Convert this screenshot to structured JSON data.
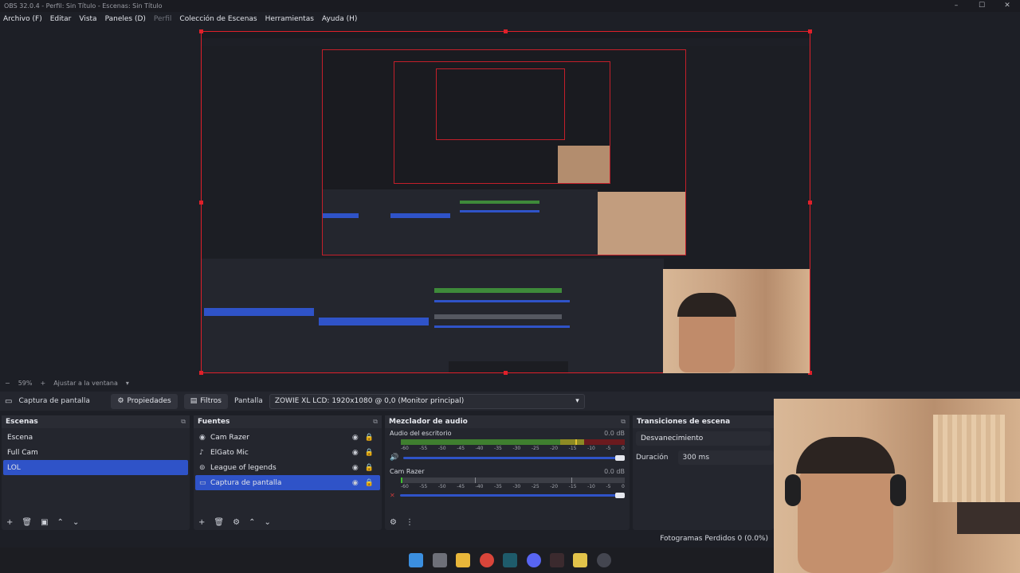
{
  "window": {
    "title": "OBS 32.0.4 - Perfil: Sin Título - Escenas: Sin Título",
    "controls": [
      "–",
      "☐",
      "✕"
    ]
  },
  "menu": {
    "items": [
      "Archivo (F)",
      "Editar",
      "Vista",
      "Paneles (D)",
      "Perfil",
      "Colección de Escenas",
      "Herramientas",
      "Ayuda (H)"
    ]
  },
  "zoom": {
    "minus": "−",
    "level": "59%",
    "plus": "+",
    "fit_label": "Ajustar a la ventana",
    "dropdown": "▾"
  },
  "context": {
    "source_name": "Captura de pantalla",
    "properties_label": "Propiedades",
    "filters_label": "Filtros",
    "display_label": "Pantalla",
    "display_value": "ZOWIE XL LCD: 1920x1080 @ 0,0 (Monitor principal)"
  },
  "scenes": {
    "title": "Escenas",
    "items": [
      "Escena",
      "Full Cam",
      "LOL"
    ],
    "selected_index": 2
  },
  "sources": {
    "title": "Fuentes",
    "items": [
      {
        "icon": "camera-icon",
        "glyph": "◉",
        "label": "Cam Razer"
      },
      {
        "icon": "microphone-icon",
        "glyph": "♪",
        "label": "ElGato Mic"
      },
      {
        "icon": "gamepad-icon",
        "glyph": "⊚",
        "label": "League of legends"
      },
      {
        "icon": "monitor-icon",
        "glyph": "▭",
        "label": "Captura de pantalla"
      }
    ],
    "selected_index": 3
  },
  "mixer": {
    "title": "Mezclador de audio",
    "channels": [
      {
        "name": "Audio del escritorio",
        "db": "0.0 dB",
        "level": 0.78,
        "active": true
      },
      {
        "name": "Cam Razer",
        "db": "0.0 dB",
        "level": 0.0,
        "active": false
      }
    ],
    "ticks": [
      "-60",
      "-55",
      "-50",
      "-45",
      "-40",
      "-35",
      "-30",
      "-25",
      "-20",
      "-15",
      "-10",
      "-5",
      "0"
    ]
  },
  "transitions": {
    "title": "Transiciones de escena",
    "selected": "Desvanecimiento",
    "duration_label": "Duración",
    "duration_value": "300 ms"
  },
  "status": {
    "dropped_frames": "Fotogramas Perdidos 0 (0.0%)"
  },
  "colors": {
    "accent": "#2f53c8",
    "selection_border": "#e0202a",
    "background": "#1d1f26",
    "panel": "#24262e"
  },
  "taskbar": {
    "icons": [
      "windows-start-icon",
      "task-view-icon",
      "file-explorer-icon",
      "chrome-icon",
      "league-launcher-icon",
      "discord-icon",
      "obs-icon",
      "valorant-icon",
      "steam-icon"
    ]
  }
}
